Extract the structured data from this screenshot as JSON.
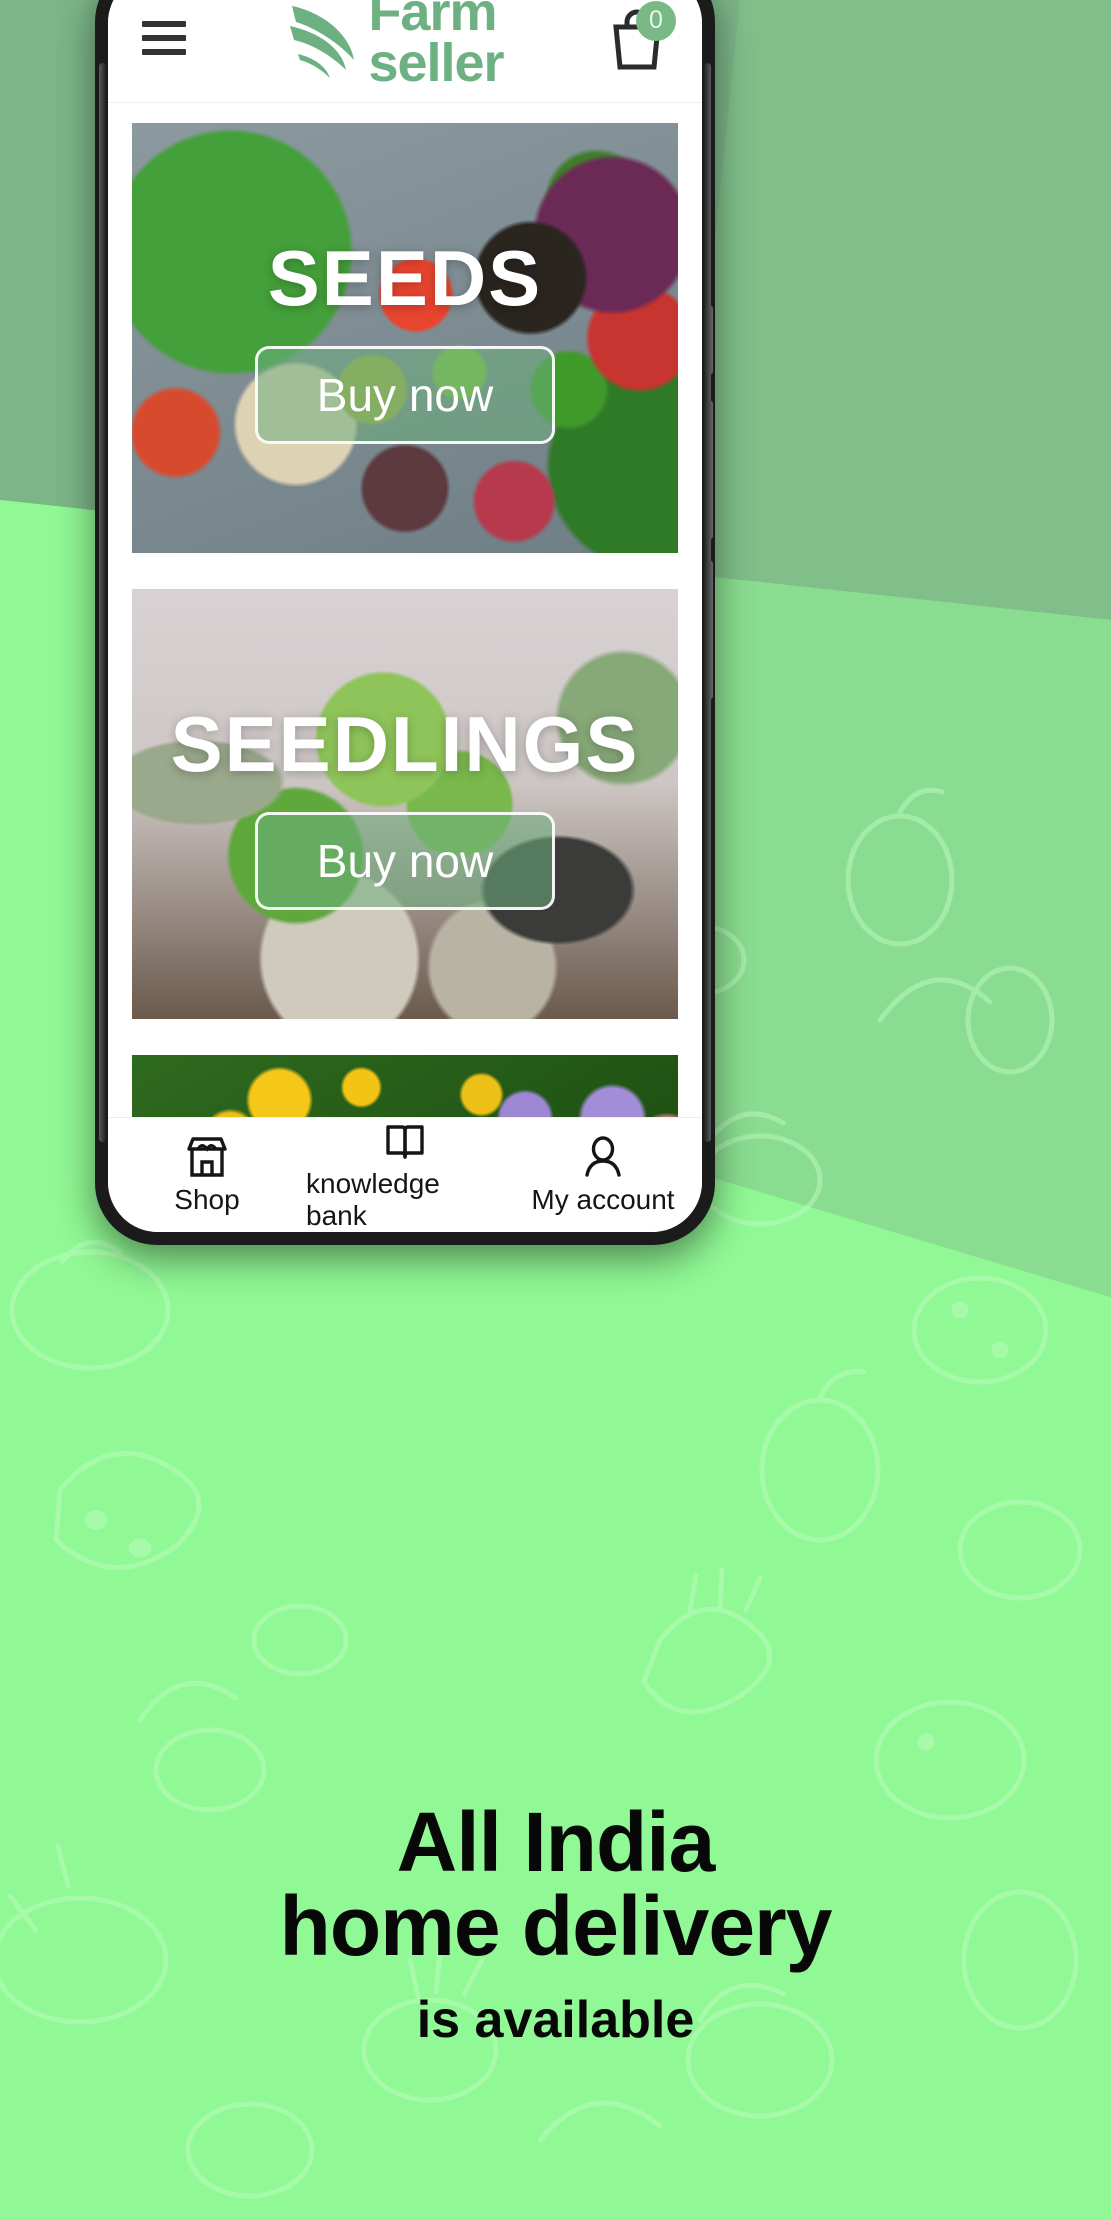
{
  "brand": {
    "name_line1": "Farm",
    "name_line2": "seller",
    "logo_icon": "leaf-wing-icon",
    "color": "#6db183"
  },
  "header": {
    "menu_icon": "hamburger-menu-icon",
    "cart_icon": "shopping-bag-icon",
    "cart_count": "0",
    "cart_badge_color": "#78b985"
  },
  "banners": [
    {
      "title": "SEEDS",
      "cta": "Buy now",
      "image": "seeds-assortment-photo"
    },
    {
      "title": "SEEDLINGS",
      "cta": "Buy now",
      "image": "potted-seedlings-photo"
    },
    {
      "title": "",
      "cta": "",
      "image": "flower-garden-photo"
    }
  ],
  "bottom_nav": [
    {
      "label": "Shop",
      "icon": "storefront-icon"
    },
    {
      "label": "knowledge bank",
      "icon": "open-book-icon"
    },
    {
      "label": "My account",
      "icon": "person-icon"
    }
  ],
  "tagline": {
    "line1": "All India",
    "line2": "home delivery",
    "line3": "is available"
  },
  "background": {
    "base_color": "#8bf58f",
    "dark_color": "#7cb587",
    "doodle_theme": "fruits-and-vegetables-outline-pattern"
  }
}
